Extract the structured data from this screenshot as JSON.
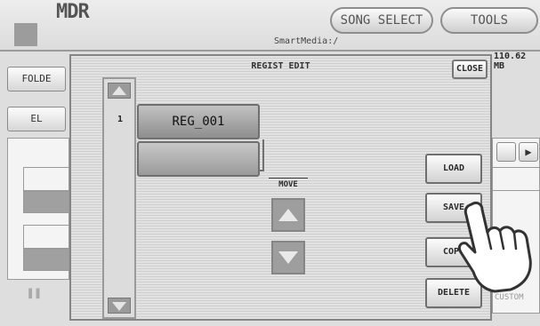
{
  "header": {
    "app_title": "MDR",
    "media_path": "SmartMedia:/",
    "song_select_label": "SONG SELECT",
    "tools_label": "TOOLS"
  },
  "background": {
    "folder_label": "FOLDE",
    "el_label": "EL",
    "capacity": "110.62 MB",
    "custom_label": "CUSTOM"
  },
  "dialog": {
    "title": "REGIST EDIT",
    "close_label": "CLOSE",
    "slot_number": "1",
    "slots": [
      "REG_001",
      ""
    ],
    "move_label": "MOVE",
    "buttons": {
      "load": "LOAD",
      "save": "SAVE",
      "copy": "COPY",
      "delete": "DELETE"
    }
  }
}
